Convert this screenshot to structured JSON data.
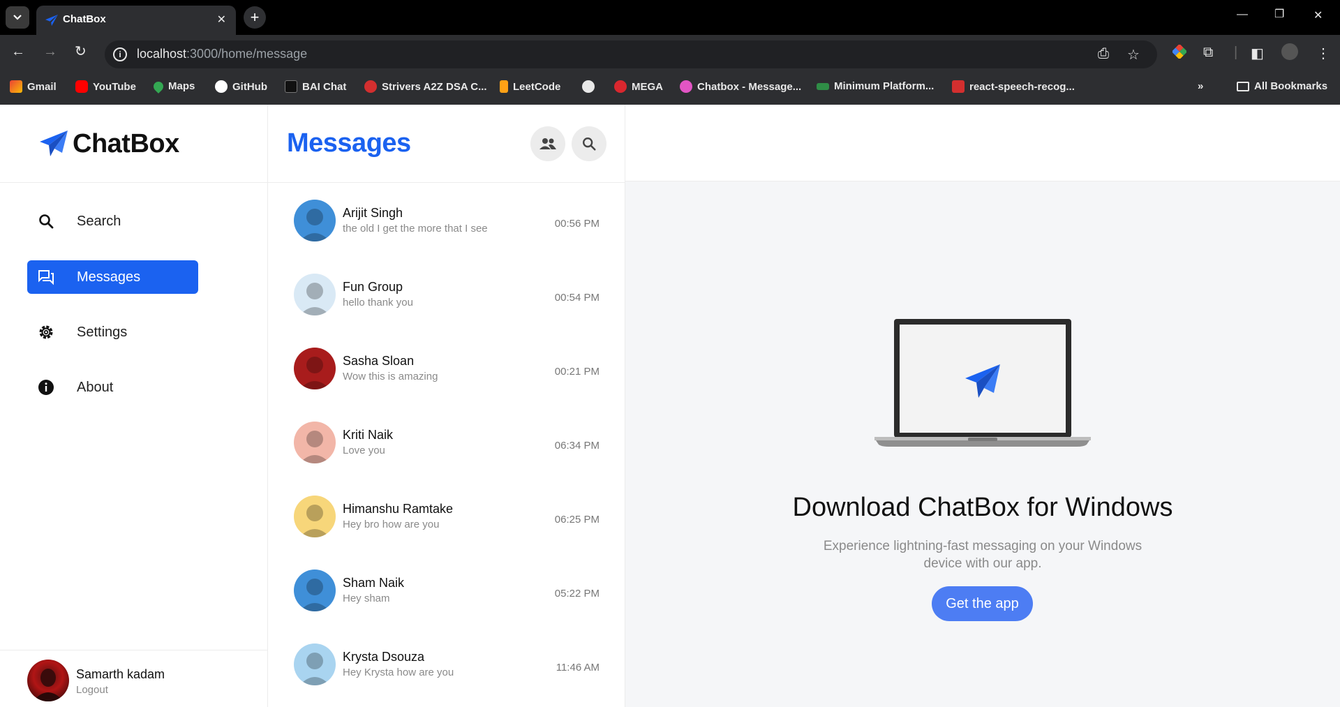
{
  "browser": {
    "tab_title": "ChatBox",
    "url_host": "localhost",
    "url_rest": ":3000/home/message",
    "bookmarks": [
      "Gmail",
      "YouTube",
      "Maps",
      "GitHub",
      "BAI Chat",
      "Strivers A2Z DSA C...",
      "LeetCode",
      "",
      "MEGA",
      "Chatbox - Message...",
      "Minimum Platform...",
      "react-speech-recog..."
    ],
    "all_bookmarks": "All Bookmarks",
    "bookmark_colors": [
      "#ea4335",
      "#ff0000",
      "#34a853",
      "#ffffff",
      "#1a1a1a",
      "#d32f2f",
      "#ffa116",
      "#e8e8e8",
      "#d9272e",
      "#e255c4",
      "#2f8d46",
      "#d32f2f"
    ]
  },
  "app": {
    "brand": "ChatBox",
    "accent": "#1b62f0",
    "nav": [
      {
        "label": "Search",
        "icon": "search-icon"
      },
      {
        "label": "Messages",
        "icon": "messages-icon"
      },
      {
        "label": "Settings",
        "icon": "gear-icon"
      },
      {
        "label": "About",
        "icon": "info-icon"
      }
    ],
    "profile": {
      "name": "Samarth kadam",
      "action": "Logout"
    }
  },
  "list": {
    "title": "Messages",
    "chats": [
      {
        "name": "Arijit Singh",
        "message": "the old I get the more that I see",
        "time": "00:56 PM",
        "avatar_color": "#3f8fd8"
      },
      {
        "name": "Fun Group",
        "message": "hello thank you",
        "time": "00:54 PM",
        "avatar_color": "#d9e9f5"
      },
      {
        "name": "Sasha Sloan",
        "message": "Wow this is amazing",
        "time": "00:21 PM",
        "avatar_color": "#a81c1c"
      },
      {
        "name": "Kriti Naik",
        "message": "Love you",
        "time": "06:34 PM",
        "avatar_color": "#f2b6a8"
      },
      {
        "name": "Himanshu Ramtake",
        "message": "Hey bro how are you",
        "time": "06:25 PM",
        "avatar_color": "#f7d67a"
      },
      {
        "name": "Sham Naik",
        "message": "Hey sham",
        "time": "05:22 PM",
        "avatar_color": "#3f8fd8"
      },
      {
        "name": "Krysta Dsouza",
        "message": "Hey Krysta how are you",
        "time": "11:46 AM",
        "avatar_color": "#a9d4f0"
      }
    ]
  },
  "main": {
    "title": "Download ChatBox for Windows",
    "subtitle": "Experience lightning-fast messaging on your Windows device with our app.",
    "button": "Get the app"
  }
}
